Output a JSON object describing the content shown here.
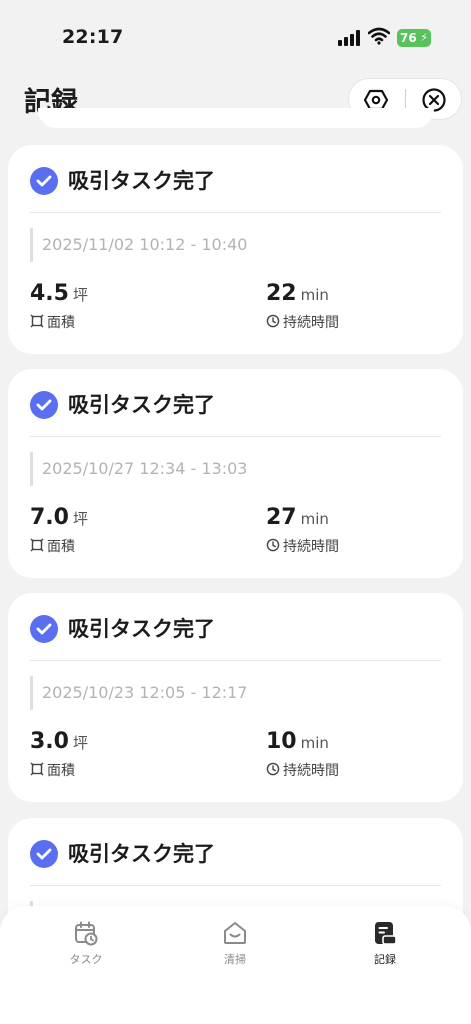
{
  "status_bar": {
    "time": "22:17",
    "battery": "76"
  },
  "header": {
    "title": "記録"
  },
  "records": [
    {
      "title": "吸引タスク完了",
      "time_range": "2025/11/02 10:12 - 10:40",
      "area_value": "4.5",
      "area_unit": "坪",
      "area_label": "面積",
      "duration_value": "22",
      "duration_unit": "min",
      "duration_label": "持続時間"
    },
    {
      "title": "吸引タスク完了",
      "time_range": "2025/10/27 12:34 - 13:03",
      "area_value": "7.0",
      "area_unit": "坪",
      "area_label": "面積",
      "duration_value": "27",
      "duration_unit": "min",
      "duration_label": "持続時間"
    },
    {
      "title": "吸引タスク完了",
      "time_range": "2025/10/23 12:05 - 12:17",
      "area_value": "3.0",
      "area_unit": "坪",
      "area_label": "面積",
      "duration_value": "10",
      "duration_unit": "min",
      "duration_label": "持続時間"
    },
    {
      "title": "吸引タスク完了"
    }
  ],
  "tab_bar": {
    "tabs": [
      {
        "label": "タスク",
        "icon": "calendar-clock-icon"
      },
      {
        "label": "清掃",
        "icon": "home-icon"
      },
      {
        "label": "記録",
        "icon": "record-book-icon",
        "active": true
      }
    ]
  },
  "colors": {
    "accent": "#5a6ff0",
    "battery": "#58c35a",
    "background": "#f2f2f2"
  }
}
